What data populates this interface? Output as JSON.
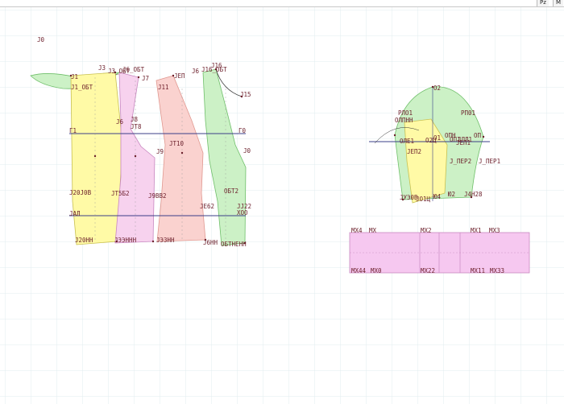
{
  "toolbar": {
    "item1": "Pz",
    "item2": "M"
  },
  "colors": {
    "grid": "#e2ecef",
    "piece_yellow": "#fffaa6",
    "piece_pink": "#f7d2ee",
    "piece_salmon": "#fad2cf",
    "piece_green": "#ccf1c6",
    "piece_band": "#f6c8f0",
    "guide_line": "#3b3f88",
    "label": "#6b1e2a"
  },
  "labels": {
    "bodice": [
      "Ј0",
      "Ј3",
      "Ј3_ОБТ",
      "Ј6_ОБТ",
      "Ј7",
      "Ј1",
      "Ј1_ОБТ",
      "Ј11",
      "ЈЕП",
      "Ј6",
      "Ј16",
      "Ј16_ОБТ",
      "Ј15",
      "Ј8",
      "ЈТ8",
      "Ј6",
      "Г1",
      "Г0",
      "ЈТ10",
      "Ј9",
      "Ј20Ј0В",
      "ЈТ5Б2",
      "Ј9ВВ2",
      "ЈЕ62",
      "ЈЈ22",
      "ХОО",
      "ОБТ2",
      "ЈАЛ",
      "Ј20НН",
      "ЈЭЭННН",
      "ЈЭЗНН",
      "Ј6НН",
      "ОБТНЕНН",
      "Ј0"
    ],
    "sleeve": [
      "О2",
      "РЛО1",
      "ОЛПНН",
      "РП01",
      "О1",
      "ОПН",
      "ОП",
      "ОЛЕ1",
      "ЈЕП2",
      "Ј_ПЕР2",
      "Ј_ПЕР1",
      "ЈЕП1",
      "О2Ц",
      "Ю4",
      "ЈУЭ0В",
      "ЈО1Ц",
      "Ј4Н28",
      "Ю2",
      "ОП1",
      "ЈЛЛ1"
    ],
    "band": [
      "МХ4",
      "МХ",
      "МХ2",
      "МХ1",
      "МХ3",
      "МХ44",
      "МХ0",
      "МХ22",
      "МХ11",
      "МХ33"
    ]
  }
}
